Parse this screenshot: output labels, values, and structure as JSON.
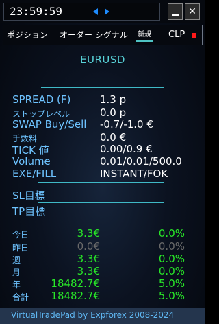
{
  "titlebar": {
    "clock": "23:59:59",
    "minimize_label": "_",
    "close_label": "✕"
  },
  "tabs": {
    "positions": "ポジション",
    "orders": "オーダー シグナル",
    "new": "新規",
    "clp": "CLP",
    "clp_indicator_color": "#ff1a1a"
  },
  "symbol": "EURUSD",
  "details": [
    {
      "label": "SPREAD (F)",
      "value": "1.3 p",
      "small": false
    },
    {
      "label": "ストップレベル",
      "value": "0.0 p",
      "small": true
    },
    {
      "label": "SWAP Buy/Sell",
      "value": "-0.7/-1.0 €",
      "small": false
    },
    {
      "label": "手数料",
      "value": "0.0 €",
      "small": true
    },
    {
      "label": "TICK 値",
      "value": "0.00/0.9 €",
      "small": false
    },
    {
      "label": "Volume",
      "value": "0.01/0.01/500.0",
      "small": false
    },
    {
      "label": "EXE/FILL",
      "value": "INSTANT/FOK",
      "small": false
    }
  ],
  "sl_label": "SL目標",
  "tp_label": "TP目標",
  "stats": [
    {
      "label": "今日",
      "amount": "3.3€",
      "percent": "0.0%",
      "color": "green"
    },
    {
      "label": "昨日",
      "amount": "0.0€",
      "percent": "0.0%",
      "color": "gray"
    },
    {
      "label": "週",
      "amount": "3.3€",
      "percent": "0.0%",
      "color": "green"
    },
    {
      "label": "月",
      "amount": "3.3€",
      "percent": "0.0%",
      "color": "green"
    },
    {
      "label": "年",
      "amount": "18482.7€",
      "percent": "5.0%",
      "color": "green"
    },
    {
      "label": "合計",
      "amount": "18482.7€",
      "percent": "5.0%",
      "color": "green"
    }
  ],
  "footer": "VirtualTradePad by Expforex 2008-2024",
  "colors": {
    "accent_cyan": "#58d2d8",
    "label_blue": "#6ec3ff",
    "profit_green": "#28e628",
    "neutral_gray": "#6a6a6a"
  }
}
